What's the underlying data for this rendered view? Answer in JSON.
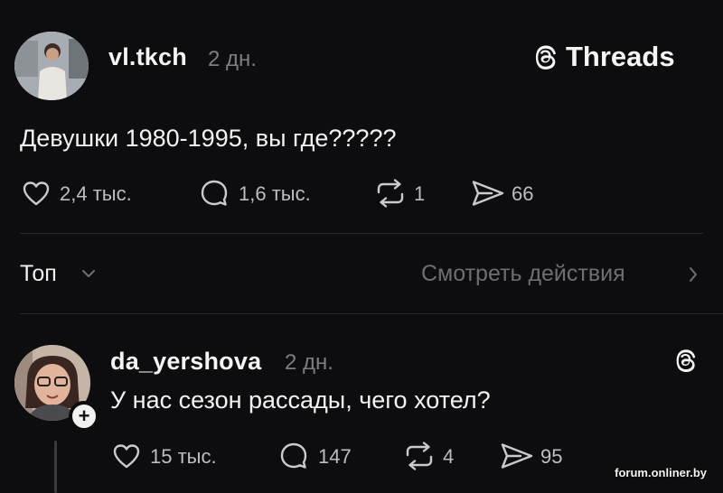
{
  "app": {
    "brand_label": "Threads",
    "brand_icon": "threads-logo-icon"
  },
  "post": {
    "username": "vl.tkch",
    "time": "2 дн.",
    "text": "Девушки 1980-1995, вы где?????",
    "likes": "2,4 тыс.",
    "replies": "1,6 тыс.",
    "reposts": "1",
    "shares": "66"
  },
  "filter": {
    "sort_label": "Топ",
    "view_activity_label": "Смотреть действия"
  },
  "reply": {
    "username": "da_yershova",
    "time": "2 дн.",
    "text": "У нас сезон рассады, чего хотел?",
    "likes": "15 тыс.",
    "replies": "147",
    "reposts": "4",
    "shares": "95"
  },
  "watermark": "forum.onliner.by",
  "colors": {
    "background": "#0d0c0e",
    "text": "#f2f2f2",
    "muted": "#7d7d82"
  }
}
